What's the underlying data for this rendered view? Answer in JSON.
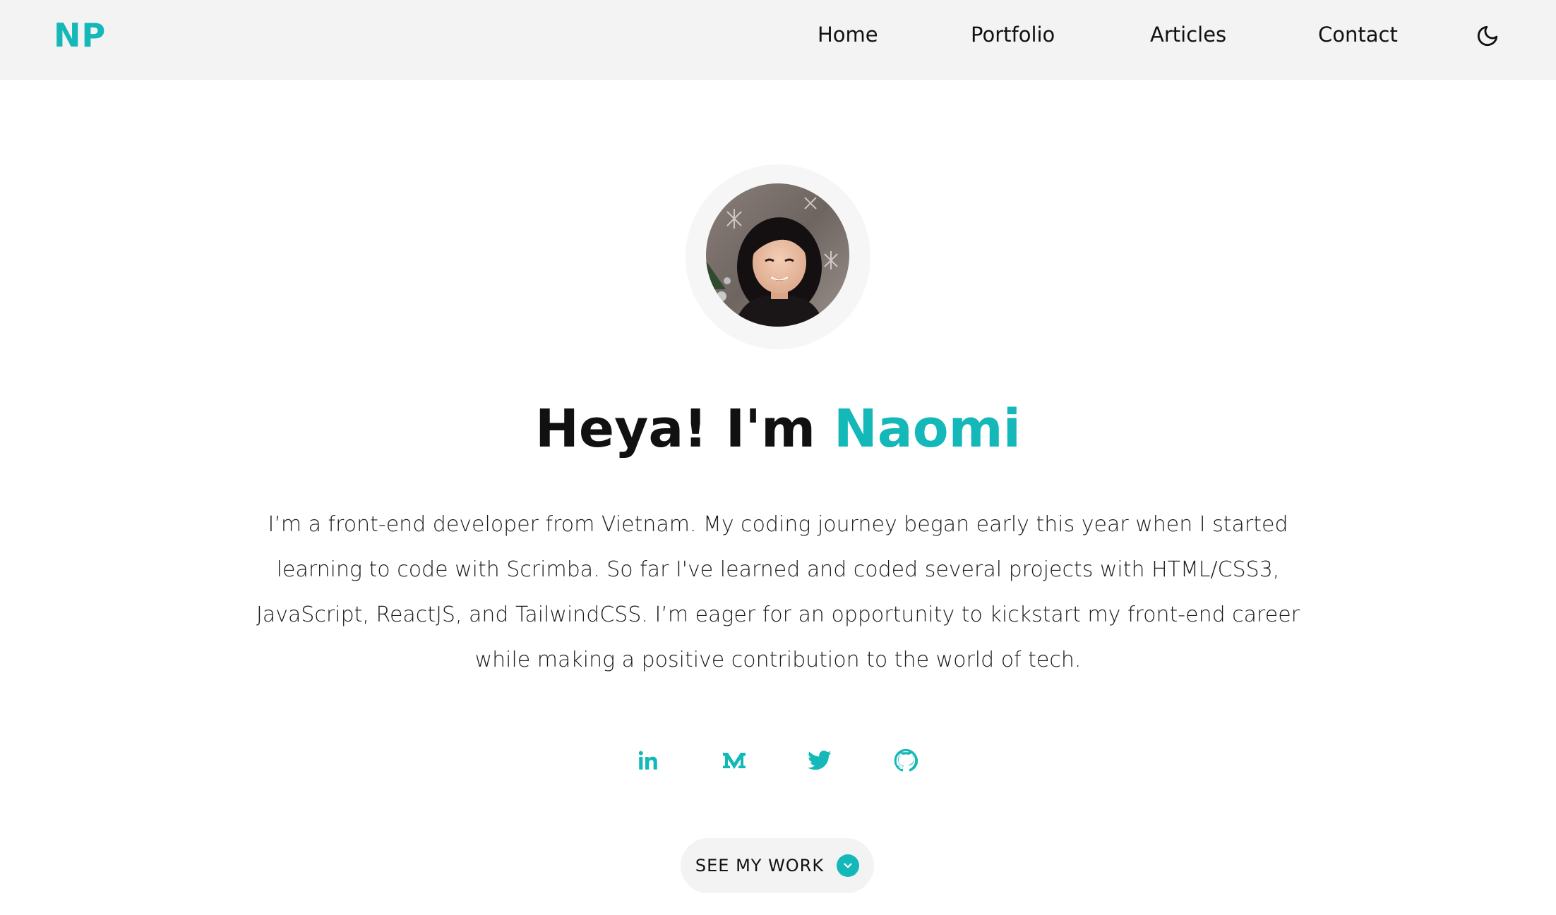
{
  "theme": {
    "accent": "#14b8b8",
    "header_bg": "#f3f3f3",
    "text": "#111111"
  },
  "header": {
    "logo": "NP",
    "nav": [
      {
        "label": "Home"
      },
      {
        "label": "Portfolio"
      },
      {
        "label": "Articles"
      },
      {
        "label": "Contact"
      }
    ],
    "theme_toggle_icon": "moon-icon"
  },
  "hero": {
    "avatar_icon": "profile-photo",
    "greeting": "Heya! I'm ",
    "name": "Naomi",
    "bio": "I’m a front-end developer from Vietnam. My coding journey began early this year when I started learning to code with Scrimba. So far I've learned and coded several projects with HTML/CSS3, JavaScript, ReactJS, and TailwindCSS. I’m eager for an opportunity to kickstart my front-end career while making a positive contribution to the world of tech."
  },
  "social": [
    {
      "icon": "linkedin-icon"
    },
    {
      "icon": "medium-icon"
    },
    {
      "icon": "twitter-icon"
    },
    {
      "icon": "github-icon"
    }
  ],
  "cta": {
    "label": "SEE MY WORK",
    "icon": "chevron-down-icon"
  }
}
